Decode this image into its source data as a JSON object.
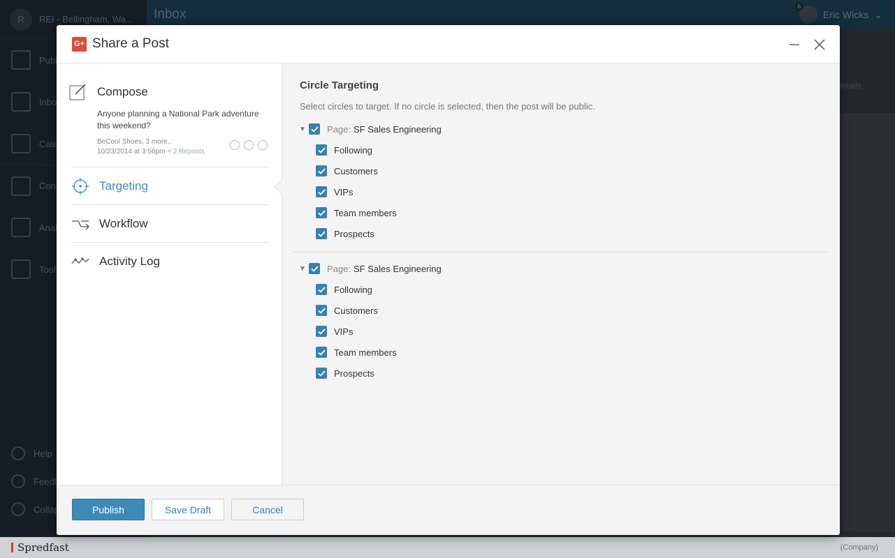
{
  "app": {
    "brand_letter": "R",
    "brand_name": "REI - Bellingham, Wa...",
    "inbox_title": "Inbox",
    "user_name": "Eric Wicks",
    "notification_count": "6",
    "nav": [
      "Publish",
      "Inbox",
      "Calendar",
      "Content",
      "Analytics",
      "Tools"
    ],
    "bottom_nav": [
      "Help",
      "Feedback",
      "Collapse"
    ],
    "details_label": "Details",
    "footer_logo": "Spredfast",
    "footer_company": "(Company)"
  },
  "modal": {
    "network_icon": "G+",
    "title": "Share a Post",
    "compose": {
      "title": "Compose",
      "body": "Anyone planning a National Park adventure this weekend?",
      "meta_author": "BeCool Shoes, 3 more..",
      "meta_date": "10/23/2014 at 3:56pm",
      "meta_reposts": "+ 2 Reposts"
    },
    "nav": {
      "targeting": "Targeting",
      "workflow": "Workflow",
      "activity": "Activity Log"
    },
    "targeting": {
      "title": "Circle Targeting",
      "description": "Select circles to target. If no circle is selected, then the post will be public.",
      "groups": [
        {
          "page_label": "Page:",
          "page_name": "SF Sales Engineering",
          "circles": [
            "Following",
            "Customers",
            "VIPs",
            "Team members",
            "Prospects"
          ]
        },
        {
          "page_label": "Page:",
          "page_name": "SF Sales Engineering",
          "circles": [
            "Following",
            "Customers",
            "VIPs",
            "Team members",
            "Prospects"
          ]
        }
      ]
    },
    "footer": {
      "publish": "Publish",
      "save_draft": "Save Draft",
      "cancel": "Cancel"
    }
  },
  "colors": {
    "accent": "#3a8fc0",
    "checkbox": "#3783b0",
    "gplus": "#dd4b39"
  }
}
